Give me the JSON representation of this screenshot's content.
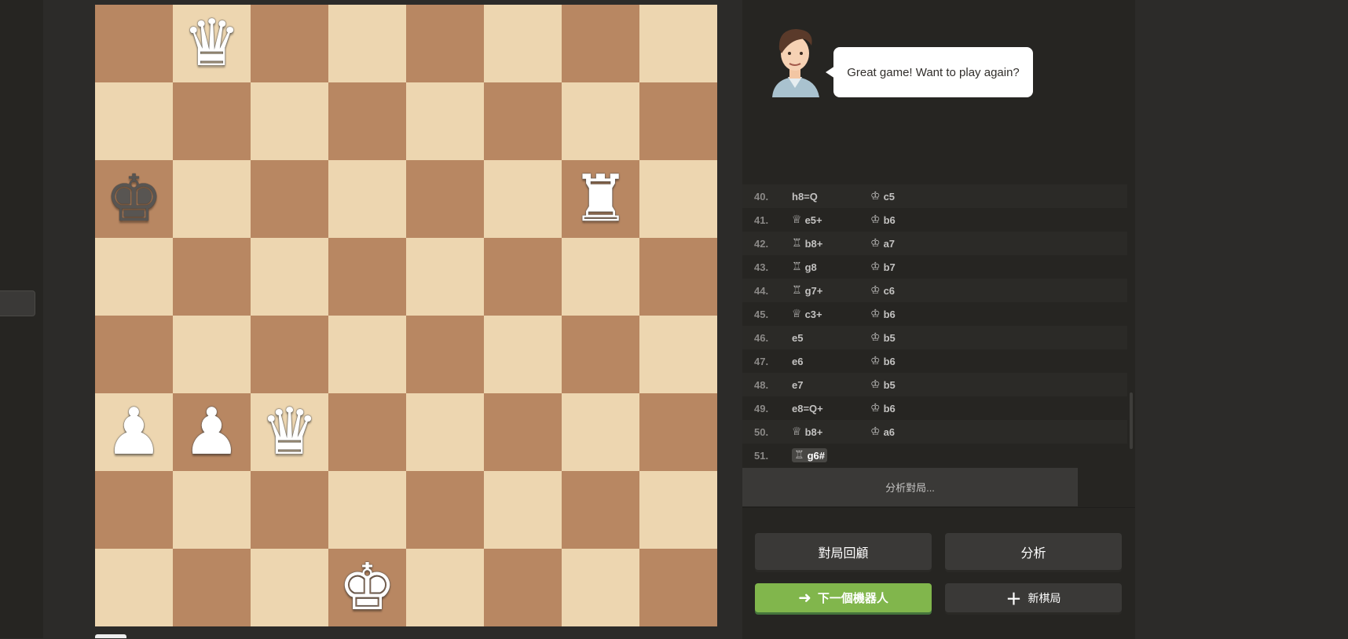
{
  "board": {
    "light_color": "#edd6b0",
    "dark_color": "#b88762",
    "pieces": [
      {
        "square": "b8",
        "piece": "queen",
        "color": "white",
        "glyph": "♛"
      },
      {
        "square": "a6",
        "piece": "king",
        "color": "black",
        "glyph": "♚"
      },
      {
        "square": "g6",
        "piece": "rook",
        "color": "white",
        "glyph": "♜"
      },
      {
        "square": "a3",
        "piece": "pawn",
        "color": "white",
        "glyph": "♟"
      },
      {
        "square": "b3",
        "piece": "pawn",
        "color": "white",
        "glyph": "♟"
      },
      {
        "square": "c3",
        "piece": "queen",
        "color": "white",
        "glyph": "♛"
      },
      {
        "square": "d1",
        "piece": "king",
        "color": "white",
        "glyph": "♚"
      }
    ]
  },
  "coach": {
    "message": "Great game! Want to play again?",
    "avatar_icon": "coach-avatar"
  },
  "moves": [
    {
      "num": "40.",
      "white": {
        "icon": "",
        "san": "h8=Q"
      },
      "black": {
        "icon": "♔",
        "san": "c5"
      }
    },
    {
      "num": "41.",
      "white": {
        "icon": "♕",
        "san": "e5+"
      },
      "black": {
        "icon": "♔",
        "san": "b6"
      }
    },
    {
      "num": "42.",
      "white": {
        "icon": "♖",
        "san": "b8+"
      },
      "black": {
        "icon": "♔",
        "san": "a7"
      }
    },
    {
      "num": "43.",
      "white": {
        "icon": "♖",
        "san": "g8"
      },
      "black": {
        "icon": "♔",
        "san": "b7"
      }
    },
    {
      "num": "44.",
      "white": {
        "icon": "♖",
        "san": "g7+"
      },
      "black": {
        "icon": "♔",
        "san": "c6"
      }
    },
    {
      "num": "45.",
      "white": {
        "icon": "♕",
        "san": "c3+"
      },
      "black": {
        "icon": "♔",
        "san": "b6"
      }
    },
    {
      "num": "46.",
      "white": {
        "icon": "",
        "san": "e5"
      },
      "black": {
        "icon": "♔",
        "san": "b5"
      }
    },
    {
      "num": "47.",
      "white": {
        "icon": "",
        "san": "e6"
      },
      "black": {
        "icon": "♔",
        "san": "b6"
      }
    },
    {
      "num": "48.",
      "white": {
        "icon": "",
        "san": "e7"
      },
      "black": {
        "icon": "♔",
        "san": "b5"
      }
    },
    {
      "num": "49.",
      "white": {
        "icon": "",
        "san": "e8=Q+"
      },
      "black": {
        "icon": "♔",
        "san": "b6"
      }
    },
    {
      "num": "50.",
      "white": {
        "icon": "♕",
        "san": "b8+"
      },
      "black": {
        "icon": "♔",
        "san": "a6"
      }
    },
    {
      "num": "51.",
      "white": {
        "icon": "♖",
        "san": "g6#"
      },
      "black": null
    }
  ],
  "analyze_link": "分析對局...",
  "buttons": {
    "game_review": "對局回顧",
    "analysis": "分析",
    "next_bot": "下一個機器人",
    "next_bot_icon": "arrow-right-icon",
    "new_game": "新棋局",
    "new_game_icon": "plus-icon",
    "green": "#81b64c"
  }
}
